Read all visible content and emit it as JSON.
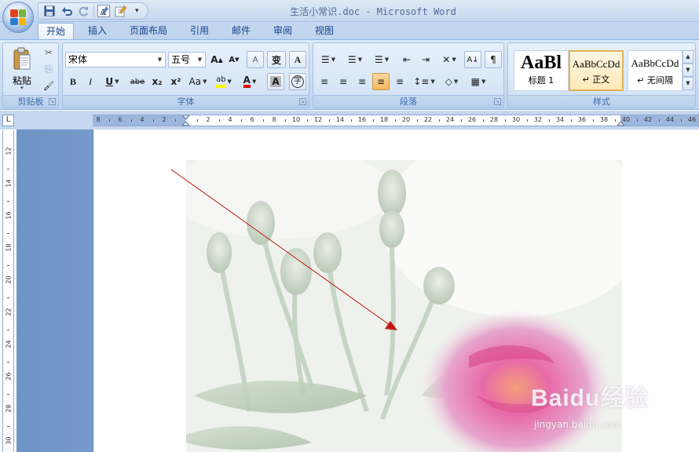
{
  "window": {
    "title": "生活小常识.doc - Microsoft Word"
  },
  "quick_access": {
    "items": [
      {
        "name": "save-icon",
        "glyph": "▣"
      },
      {
        "name": "undo-icon",
        "glyph": "↶"
      },
      {
        "name": "redo-icon",
        "glyph": "↻"
      },
      {
        "name": "text-style-icon",
        "glyph": "A"
      },
      {
        "name": "edit-icon",
        "glyph": "✎"
      }
    ],
    "more": "▾"
  },
  "tabs": [
    {
      "label": "开始",
      "active": true
    },
    {
      "label": "插入",
      "active": false
    },
    {
      "label": "页面布局",
      "active": false
    },
    {
      "label": "引用",
      "active": false
    },
    {
      "label": "邮件",
      "active": false
    },
    {
      "label": "审阅",
      "active": false
    },
    {
      "label": "视图",
      "active": false
    }
  ],
  "clipboard": {
    "group_label": "剪贴板",
    "paste_label": "粘贴",
    "cut_icon": "✂",
    "copy_icon": "⎘",
    "format_painter_icon": "🖌"
  },
  "font": {
    "group_label": "字体",
    "font_name": "宋体",
    "font_size": "五号",
    "grow": "A",
    "shrink": "A",
    "clear": "A",
    "phonetic": "变",
    "border": "A",
    "bold": "B",
    "italic": "I",
    "underline": "U",
    "strike": "abe",
    "subscript": "x₂",
    "superscript": "x²",
    "change_case": "Aa",
    "highlight": "ab",
    "font_color": "A",
    "shading": "A",
    "enclose": "字"
  },
  "paragraph": {
    "group_label": "段落",
    "bullets": "☰",
    "numbering": "☰",
    "multilevel": "☰",
    "decrease_indent": "⇤",
    "increase_indent": "⇥",
    "asian_layout": "✕",
    "sort": "A↓",
    "show_marks": "¶",
    "align_left": "≡",
    "center": "≡",
    "align_right": "≡",
    "justify": "≡",
    "distributed": "≡",
    "line_spacing": "↕≡",
    "fill": "◇",
    "borders": "▦"
  },
  "styles": {
    "group_label": "样式",
    "items": [
      {
        "sample": "AaBl",
        "name": "标题 1",
        "selected": false
      },
      {
        "sample": "AaBbCcDd",
        "name": "↵ 正文",
        "selected": true
      },
      {
        "sample": "AaBbCcDd",
        "name": "↵ 无间隔",
        "selected": false
      }
    ]
  },
  "ruler": {
    "corner": "L",
    "h_ticks": [
      "8",
      "6",
      "4",
      "2",
      "",
      "2",
      "4",
      "6",
      "8",
      "10",
      "12",
      "14",
      "16",
      "18",
      "20",
      "22",
      "24",
      "26",
      "28",
      "30",
      "32",
      "34",
      "36",
      "38",
      "40",
      "42",
      "44",
      "46"
    ],
    "v_ticks": [
      "12",
      "14",
      "16",
      "18",
      "20",
      "22",
      "24",
      "26",
      "28",
      "30"
    ]
  },
  "watermark": {
    "text": "Baidu经验",
    "url": "jingyan.baidu.com"
  },
  "colors": {
    "accent": "#15428b",
    "arrow": "#c0160f",
    "highlight": "#ffff00",
    "font_color": "#e00000"
  }
}
